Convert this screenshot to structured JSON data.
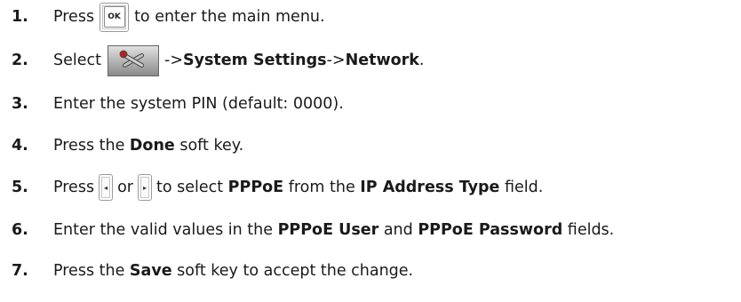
{
  "steps": [
    {
      "num": "1.",
      "parts": [
        "Press",
        "to enter the main menu."
      ]
    },
    {
      "num": "2.",
      "parts": [
        "Select",
        "->",
        "System Settings",
        "->",
        "Network",
        "."
      ]
    },
    {
      "num": "3.",
      "parts": [
        "Enter the system PIN (default: 0000)."
      ]
    },
    {
      "num": "4.",
      "parts": [
        "Press the ",
        "Done",
        " soft key."
      ]
    },
    {
      "num": "5.",
      "parts": [
        "Press",
        "or",
        "to select ",
        "PPPoE",
        " from the ",
        "IP Address Type",
        " field."
      ]
    },
    {
      "num": "6.",
      "parts": [
        "Enter the valid values in the ",
        "PPPoE User",
        " and ",
        "PPPoE Password",
        " fields."
      ]
    },
    {
      "num": "7.",
      "parts": [
        "Press the ",
        "Save",
        " soft key to accept the change."
      ]
    }
  ],
  "keys": {
    "ok_label": "OK",
    "left_arrow": "◂",
    "right_arrow": "▸"
  },
  "icons": {
    "menu_icon": "tools-icon"
  }
}
